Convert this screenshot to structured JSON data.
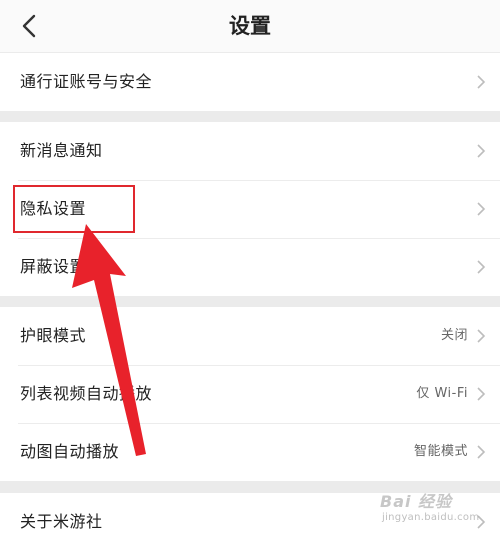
{
  "header": {
    "title": "设置",
    "back_icon": "chevron-left-icon"
  },
  "groups": [
    {
      "items": [
        {
          "label": "通行证账号与安全",
          "value": ""
        }
      ]
    },
    {
      "items": [
        {
          "label": "新消息通知",
          "value": ""
        },
        {
          "label": "隐私设置",
          "value": ""
        },
        {
          "label": "屏蔽设置",
          "value": ""
        }
      ]
    },
    {
      "items": [
        {
          "label": "护眼模式",
          "value": "关闭"
        },
        {
          "label": "列表视频自动播放",
          "value": "仅 Wi-Fi"
        },
        {
          "label": "动图自动播放",
          "value": "智能模式"
        }
      ]
    },
    {
      "items": [
        {
          "label": "关于米游社",
          "value": ""
        }
      ]
    }
  ],
  "annotation": {
    "highlight_target": "隐私设置",
    "color": "#e0282e"
  },
  "watermark": {
    "text": "Bai 经验",
    "url": "jingyan.baidu.com"
  }
}
